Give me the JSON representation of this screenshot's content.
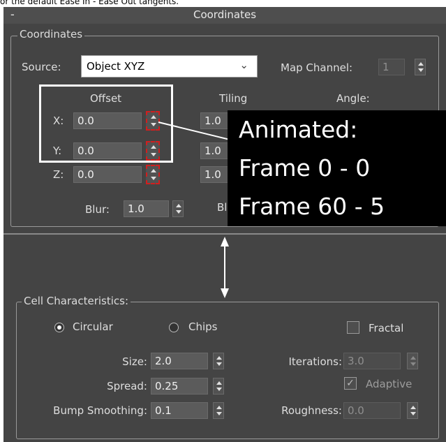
{
  "caption": "or the default Ease In - Ease Out tangents.",
  "titlebar": {
    "collapse": "-",
    "title": "Coordinates"
  },
  "coordinates": {
    "group_label": "Coordinates",
    "source_label": "Source:",
    "source_value": "Object XYZ",
    "map_channel_label": "Map Channel:",
    "map_channel_value": "1",
    "offset_label": "Offset",
    "tiling_label": "Tiling",
    "angle_label": "Angle:",
    "x_label": "X:",
    "y_label": "Y:",
    "z_label": "Z:",
    "offset_x": "0.0",
    "offset_y": "0.0",
    "offset_z": "0.0",
    "tiling_x": "1.0",
    "tiling_y": "1.0",
    "tiling_z": "1.0",
    "blur_label": "Blur:",
    "blur_value": "1.0",
    "blur_offset_label_partial": "Bl"
  },
  "annotation": {
    "line1": "Animated:",
    "line2": "Frame 0 - 0",
    "line3": "Frame 60 - 5"
  },
  "cell": {
    "group_label": "Cell Characteristics:",
    "circular_label": "Circular",
    "chips_label": "Chips",
    "fractal_label": "Fractal",
    "size_label": "Size:",
    "size_value": "2.0",
    "spread_label": "Spread:",
    "spread_value": "0.25",
    "bump_label": "Bump Smoothing:",
    "bump_value": "0.1",
    "iterations_label": "Iterations:",
    "iterations_value": "3.0",
    "adaptive_label": "Adaptive",
    "adaptive_check": "✓",
    "roughness_label": "Roughness:",
    "roughness_value": "0.0"
  },
  "colors": {
    "panel": "#444444",
    "titlebar": "#4e4e4e",
    "keyframe_marker": "#d21e1e",
    "overlay": "#000000"
  }
}
